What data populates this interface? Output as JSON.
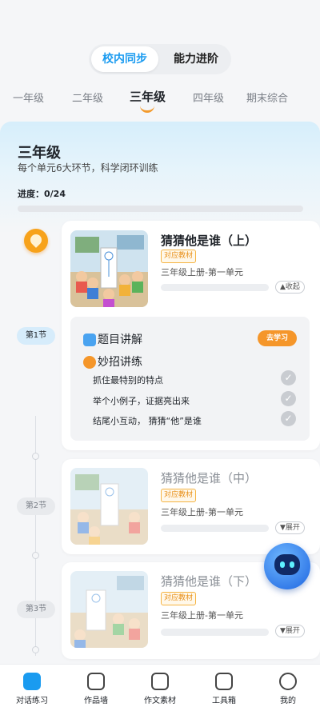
{
  "mode_switch": {
    "active": "校内同步",
    "inactive": "能力进阶"
  },
  "grades": [
    "一年级",
    "二年级",
    "三年级",
    "四年级",
    "期末综合"
  ],
  "active_grade_index": 2,
  "panel": {
    "title": "三年级",
    "subtitle": "每个单元6大环节，科学闭环训练",
    "progress_label": "进度：0/24",
    "progress_fraction": 0
  },
  "sections": [
    {
      "label": "第1节",
      "title": "猜猜他是谁（上）",
      "tag": "对应教材",
      "meta": "三年级上册-第一单元",
      "toggle": "▲收起",
      "expanded": true
    },
    {
      "label": "第2节",
      "title": "猜猜他是谁（中）",
      "tag": "对应教材",
      "meta": "三年级上册-第一单元",
      "toggle": "▼展开",
      "expanded": false
    },
    {
      "label": "第3节",
      "title": "猜猜他是谁（下）",
      "tag": "对应教材",
      "meta": "三年级上册-第一单元",
      "toggle": "▼展开",
      "expanded": false
    }
  ],
  "detail": {
    "row1": "题目讲解",
    "row1_button": "去学习",
    "row2": "妙招讲练",
    "items": [
      "抓住最特别的特点",
      "举个小例子，证据亮出来",
      "结尾小互动， 猜猜“他”是谁"
    ]
  },
  "tabs": [
    "对话练习",
    "作品墙",
    "作文素材",
    "工具箱",
    "我的"
  ],
  "active_tab_index": 0,
  "colors": {
    "accent": "#1a9bf0",
    "orange": "#f5962a",
    "tag": "#e8901a"
  }
}
